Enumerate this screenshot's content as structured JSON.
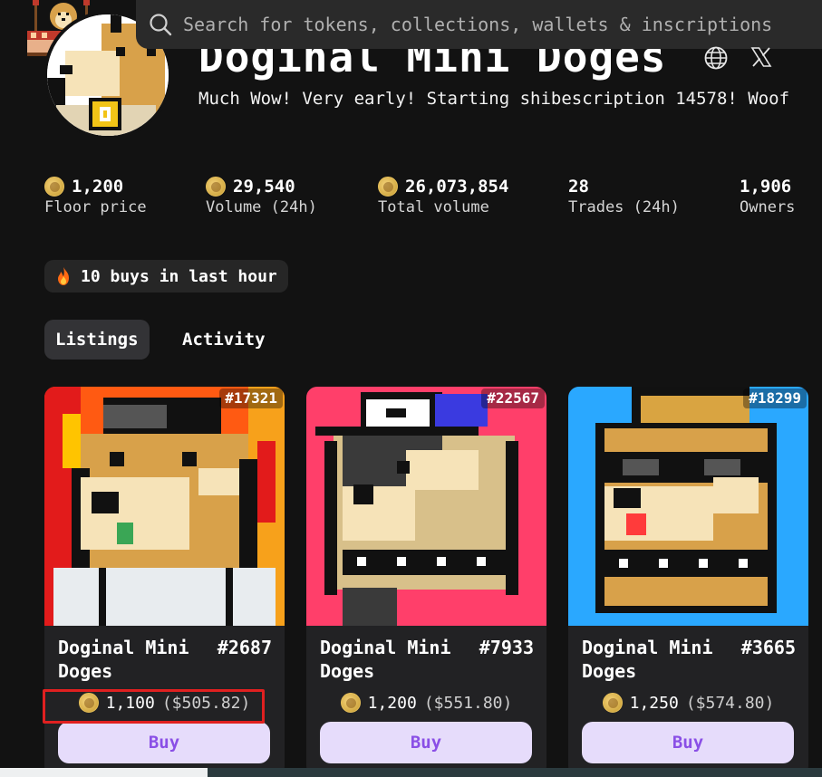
{
  "search": {
    "placeholder": "Search for tokens, collections, wallets & inscriptions"
  },
  "collection": {
    "title": "Doginal Mini Doges",
    "description": "Much Wow! Very early! Starting shibescription 14578! Woof"
  },
  "stats": [
    {
      "value": "1,200",
      "label": "Floor price",
      "coin": true
    },
    {
      "value": "29,540",
      "label": "Volume (24h)",
      "coin": true
    },
    {
      "value": "26,073,854",
      "label": "Total volume",
      "coin": true
    },
    {
      "value": "28",
      "label": "Trades (24h)",
      "coin": false
    },
    {
      "value": "1,906",
      "label": "Owners",
      "coin": false
    }
  ],
  "hot_badge": {
    "text": "10 buys in last hour"
  },
  "tabs": [
    {
      "label": "Listings",
      "active": true
    },
    {
      "label": "Activity",
      "active": false
    }
  ],
  "cards": [
    {
      "inscription": "#17321",
      "name": "Doginal Mini Doges",
      "number": "#2687",
      "price": "1,100",
      "usd": "($505.82)",
      "buy_label": "Buy",
      "bg": "#ff5a12",
      "hat": "#2a2a2a"
    },
    {
      "inscription": "#22567",
      "name": "Doginal Mini Doges",
      "number": "#7933",
      "price": "1,200",
      "usd": "($551.80)",
      "buy_label": "Buy",
      "bg": "#ff3f6a",
      "hat": "#ffffff"
    },
    {
      "inscription": "#18299",
      "name": "Doginal Mini Doges",
      "number": "#3665",
      "price": "1,250",
      "usd": "($574.80)",
      "buy_label": "Buy",
      "bg": "#2aa8ff",
      "hat": "#d9a441"
    }
  ],
  "icons": {
    "search": "search-icon",
    "globe": "globe-icon",
    "x": "x-logo-icon",
    "fire": "fire-icon",
    "coin": "dogecoin-icon"
  },
  "colors": {
    "background": "#121212",
    "buy_bg": "#e6dcfb",
    "buy_text": "#8a4fe6",
    "highlight": "#e02020"
  }
}
